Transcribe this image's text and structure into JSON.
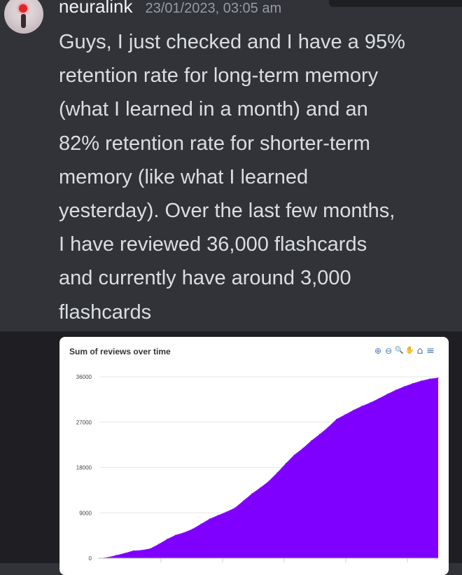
{
  "message": {
    "username": "neuralink",
    "timestamp": "23/01/2023, 03:05 am",
    "text": "Guys, I just checked and I have a 95% retention rate for long-term memory (what I learned in a month) and an 82% retention rate for shorter-term memory (like what I learned yesterday). Over the last few months, I have reviewed 36,000 flashcards and currently have around 3,000 flashcards",
    "lines": [
      "Guys, I just checked and I have a 95%",
      "retention rate for long-term memory",
      "(what I learned in a month) and an",
      "82% retention rate for shorter-term",
      "memory (like what I learned",
      "yesterday). Over the last few months,",
      "I have reviewed 36,000 flashcards",
      "and currently have around 3,000",
      "flashcards"
    ]
  },
  "toolbar": {
    "icons": [
      "zoom-in-icon",
      "zoom-out-icon",
      "magnify-icon",
      "pan-hand-icon",
      "home-icon",
      "menu-icon"
    ],
    "glyphs": [
      "⊕",
      "⊖",
      "🔍",
      "✋",
      "⌂",
      "≡"
    ]
  },
  "colors": {
    "area": "#8000ff",
    "accent": "#4a78b8",
    "background": "#313338"
  },
  "chart_data": {
    "type": "area",
    "title": "Sum of reviews over time",
    "xlabel": "",
    "ylabel": "",
    "ylim": [
      0,
      36000
    ],
    "yticks": [
      "0",
      "9000",
      "18000",
      "27000",
      "36000"
    ],
    "grid": true,
    "x": [
      0,
      1,
      2,
      3,
      4,
      5,
      6,
      7,
      8,
      9,
      10,
      11,
      12,
      13,
      14,
      15,
      16,
      17,
      18,
      19,
      20,
      21,
      22,
      23,
      24,
      25,
      26,
      27,
      28,
      29,
      30,
      31,
      32,
      33,
      34,
      35,
      36,
      37,
      38,
      39,
      40
    ],
    "values": [
      0,
      200,
      600,
      1000,
      1500,
      1600,
      1900,
      2800,
      3800,
      4600,
      5100,
      5800,
      6800,
      7800,
      8500,
      9200,
      10000,
      11400,
      12800,
      14000,
      15300,
      17000,
      18800,
      20500,
      21800,
      23300,
      24600,
      26000,
      27600,
      28500,
      29400,
      30200,
      30900,
      31700,
      32600,
      33400,
      34100,
      34700,
      35200,
      35600,
      35800
    ],
    "series": [
      {
        "name": "",
        "color": "#8000ff"
      }
    ]
  }
}
